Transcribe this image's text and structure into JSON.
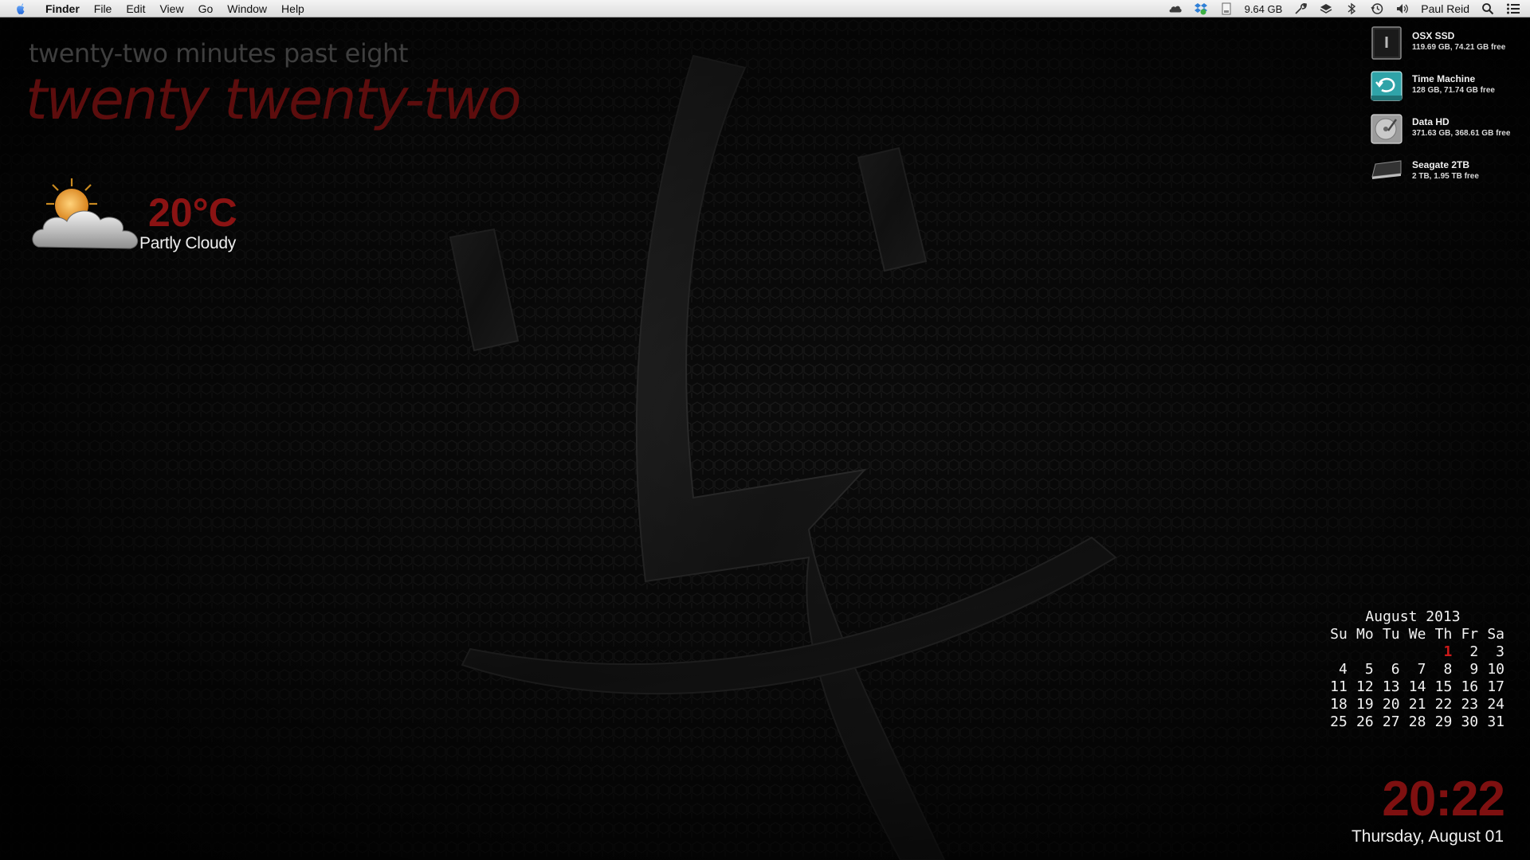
{
  "menubar": {
    "app_name": "Finder",
    "menus": [
      "File",
      "Edit",
      "View",
      "Go",
      "Window",
      "Help"
    ],
    "status_icons": [
      "cloud-icon",
      "dropbox-icon"
    ],
    "disk_status_label": "9.64 GB",
    "tray_icons": [
      "tools-icon",
      "layers-icon",
      "bluetooth-icon",
      "time-machine-icon",
      "volume-icon"
    ],
    "user_name": "Paul Reid"
  },
  "desktop": {
    "time_words": "twenty-two minutes past eight",
    "year_words": "twenty twenty-two"
  },
  "weather": {
    "icon": "partly-cloudy-icon",
    "temperature": "20°C",
    "condition": "Partly Cloudy"
  },
  "drives": [
    {
      "name": "OSX SSD",
      "info": "119.69 GB, 74.21 GB free",
      "icon": "ssd-drive-icon"
    },
    {
      "name": "Time Machine",
      "info": "128 GB, 71.74 GB free",
      "icon": "time-machine-drive-icon"
    },
    {
      "name": "Data HD",
      "info": "371.63 GB, 368.61 GB free",
      "icon": "hard-drive-icon"
    },
    {
      "name": "Seagate 2TB",
      "info": "2 TB, 1.95 TB free",
      "icon": "external-drive-icon"
    }
  ],
  "calendar": {
    "title": "August 2013",
    "weekdays": [
      "Su",
      "Mo",
      "Tu",
      "We",
      "Th",
      "Fr",
      "Sa"
    ],
    "weeks": [
      [
        "",
        "",
        "",
        "",
        "1",
        "2",
        "3"
      ],
      [
        "4",
        "5",
        "6",
        "7",
        "8",
        "9",
        "10"
      ],
      [
        "11",
        "12",
        "13",
        "14",
        "15",
        "16",
        "17"
      ],
      [
        "18",
        "19",
        "20",
        "21",
        "22",
        "23",
        "24"
      ],
      [
        "25",
        "26",
        "27",
        "28",
        "29",
        "30",
        "31"
      ]
    ],
    "today": "1",
    "today_color": "#cc1a1a"
  },
  "clock": {
    "time": "20:22",
    "date": "Thursday, August 01"
  },
  "colors": {
    "accent_red": "#7e1010",
    "background": "#070707"
  }
}
